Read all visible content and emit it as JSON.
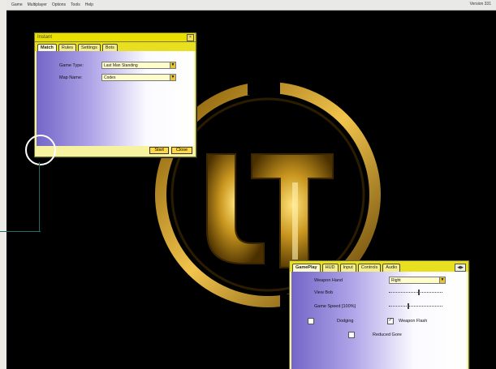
{
  "menubar": {
    "items": [
      "Game",
      "Multiplayer",
      "Options",
      "Tools",
      "Help"
    ],
    "version": "Version 331"
  },
  "instant_window": {
    "title": "Instant",
    "tabs": [
      "Match",
      "Rules",
      "Settings",
      "Bots"
    ],
    "game_type_label": "Game Type:",
    "game_type_value": "Last Man Standing",
    "map_name_label": "Map Name:",
    "map_name_value": "Codex",
    "start_label": "Start",
    "close_label": "Close"
  },
  "prefs_window": {
    "tabs": [
      "GamePlay",
      "HUD",
      "Input",
      "Controls",
      "Audio"
    ],
    "weapon_hand_label": "Weapon Hand",
    "weapon_hand_value": "Right",
    "view_bob_label": "View Bob",
    "game_speed_label": "Game Speed [100%]",
    "dodging_label": "Dodging",
    "weapon_flash_label": "Weapon Flash",
    "reduced_gore_label": "Reduced Gore",
    "view_bob_level": 0.55,
    "game_speed_level": 0.35,
    "dodging_checked": false,
    "weapon_flash_checked": true,
    "reduced_gore_checked": false
  },
  "colors": {
    "window_yellow": "#e9e000",
    "panel_purple": "#7366c8",
    "desktop": "#000000",
    "logo_gold": "#c9961f"
  },
  "icons": [
    "close-icon",
    "dropdown-arrow-icon",
    "tab-scroll-icon",
    "ut-logo"
  ]
}
